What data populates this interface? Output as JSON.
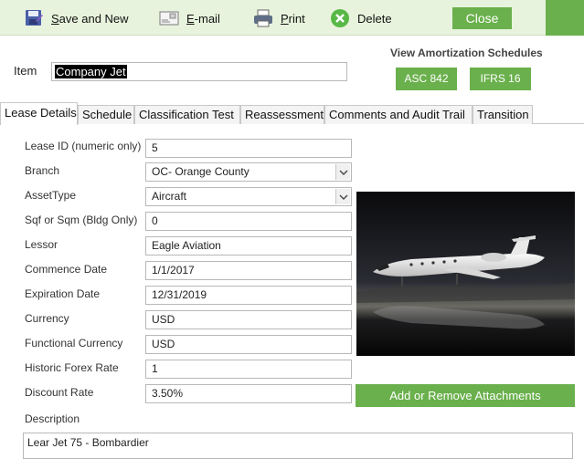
{
  "toolbar": {
    "save_new": {
      "accel": "S",
      "rest": "ave and New"
    },
    "email": {
      "accel": "E",
      "rest": "-mail"
    },
    "print": {
      "accel": "P",
      "rest": "rint"
    },
    "delete": "Delete",
    "close": "Close"
  },
  "item": {
    "label": "Item",
    "value": "Company Jet"
  },
  "amortization": {
    "title": "View Amortization Schedules",
    "asc": "ASC 842",
    "ifrs": "IFRS 16"
  },
  "tabs": [
    "Lease Details",
    "Schedule",
    "Classification Test",
    "Reassessment",
    "Comments and Audit Trail",
    "Transition"
  ],
  "fields": [
    {
      "label": "Lease ID (numeric only)",
      "value": "5"
    },
    {
      "label": "Branch",
      "value": "OC- Orange County"
    },
    {
      "label": "AssetType",
      "value": "Aircraft"
    },
    {
      "label": "Sqf or Sqm (Bldg Only)",
      "value": "0"
    },
    {
      "label": "Lessor",
      "value": "Eagle Aviation"
    },
    {
      "label": "Commence Date",
      "value": "1/1/2017"
    },
    {
      "label": "Expiration Date",
      "value": "12/31/2019"
    },
    {
      "label": "Currency",
      "value": "USD"
    },
    {
      "label": "Functional Currency",
      "value": "USD"
    },
    {
      "label": "Historic Forex Rate",
      "value": "1"
    },
    {
      "label": "Discount Rate",
      "value": "3.50%"
    }
  ],
  "attach_button": "Add or Remove Attachments",
  "description": {
    "label": "Description",
    "value": "Lear Jet 75 - Bombardier"
  },
  "colors": {
    "accent_green": "#6ab04c",
    "toolbar_bg": "#e8f3dd"
  }
}
